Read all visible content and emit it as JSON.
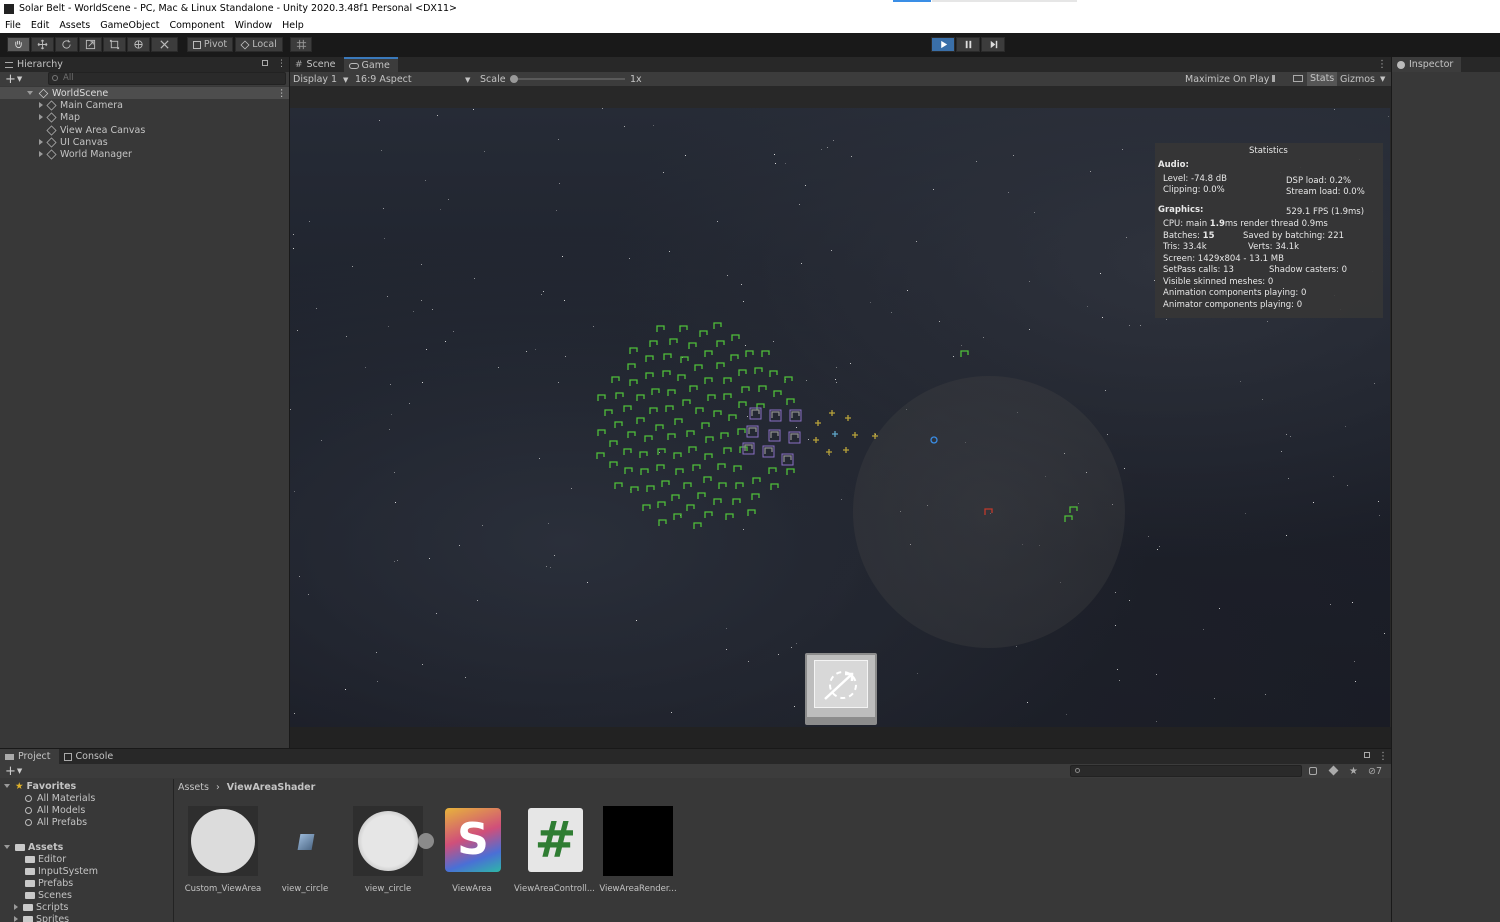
{
  "window": {
    "title": "Solar Belt - WorldScene - PC, Mac & Linux Standalone - Unity 2020.3.48f1 Personal <DX11>"
  },
  "menu": [
    "File",
    "Edit",
    "Assets",
    "GameObject",
    "Component",
    "Window",
    "Help"
  ],
  "toolbar": {
    "pivot_label": "Pivot",
    "local_label": "Local",
    "tools": [
      "hand-tool",
      "move-tool",
      "rotate-tool",
      "scale-tool",
      "rect-tool",
      "transform-tool",
      "custom-tool"
    ],
    "play_state": "playing"
  },
  "hierarchy": {
    "tab_label": "Hierarchy",
    "search_placeholder": "All",
    "scene": "WorldScene",
    "items": [
      {
        "label": "Main Camera",
        "expandable": true
      },
      {
        "label": "Map",
        "expandable": true
      },
      {
        "label": "View Area Canvas",
        "expandable": false
      },
      {
        "label": "UI Canvas",
        "expandable": true
      },
      {
        "label": "World Manager",
        "expandable": true
      }
    ]
  },
  "game": {
    "tabs": [
      {
        "label": "Scene",
        "active": false
      },
      {
        "label": "Game",
        "active": true
      }
    ],
    "display": "Display 1",
    "aspect": "16:9 Aspect",
    "scale_label": "Scale",
    "scale_value": "1x",
    "maximize_label": "Maximize On Play",
    "stats_label": "Stats",
    "gizmos_label": "Gizmos"
  },
  "statistics": {
    "title": "Statistics",
    "audio_header": "Audio:",
    "level": "Level: -74.8 dB",
    "clipping": "Clipping: 0.0%",
    "dsp": "DSP load: 0.2%",
    "stream": "Stream load: 0.0%",
    "graphics_header": "Graphics:",
    "fps": "529.1 FPS (1.9ms)",
    "cpu_prefix": "CPU: main ",
    "cpu_main": "1.9",
    "cpu_suffix": "ms  render thread 0.9ms",
    "batches_prefix": "Batches: ",
    "batches": "15",
    "saved_batching": "Saved by batching: 221",
    "tris": "Tris: 33.4k",
    "verts": "Verts: 34.1k",
    "screen": "Screen: 1429x804 - 13.1 MB",
    "setpass": "SetPass calls: 13",
    "shadow": "Shadow casters: 0",
    "skinned": "Visible skinned meshes: 0",
    "anim": "Animation components playing: 0",
    "animator": "Animator components playing: 0"
  },
  "inspector": {
    "tab_label": "Inspector"
  },
  "project": {
    "tabs": [
      {
        "label": "Project",
        "active": true
      },
      {
        "label": "Console",
        "active": false
      }
    ],
    "hidden_count": "7",
    "favorites_label": "Favorites",
    "favorites": [
      "All Materials",
      "All Models",
      "All Prefabs"
    ],
    "assets_label": "Assets",
    "folders": [
      "Editor",
      "InputSystem",
      "Prefabs",
      "Scenes",
      "Scripts",
      "Sprites"
    ],
    "breadcrumb": [
      "Assets",
      "ViewAreaShader"
    ],
    "files": [
      {
        "label": "Custom_ViewArea",
        "kind": "material-sphere"
      },
      {
        "label": "view_circle",
        "kind": "mesh"
      },
      {
        "label": "view_circle",
        "kind": "sprite-circle"
      },
      {
        "label": "ViewArea",
        "kind": "shader"
      },
      {
        "label": "ViewAreaControll...",
        "kind": "csharp-script"
      },
      {
        "label": "ViewAreaRender...",
        "kind": "render-texture"
      }
    ]
  },
  "colors": {
    "unit_green": "#4fbf3a",
    "unit_purple": "#8a6fc4",
    "unit_yellow": "#b8a23a",
    "enemy_red": "#c0392b",
    "accent_blue": "#3a79bb"
  }
}
